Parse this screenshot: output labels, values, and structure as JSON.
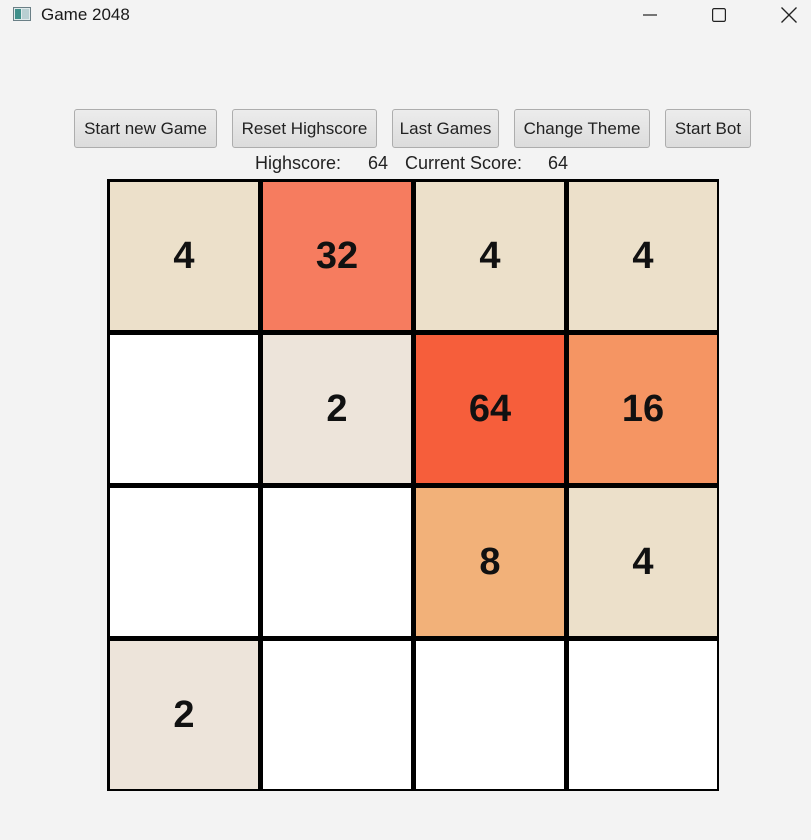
{
  "window": {
    "title": "Game 2048"
  },
  "toolbar": {
    "new_game_label": "Start new Game",
    "reset_highscore_label": "Reset Highscore",
    "last_games_label": "Last Games",
    "change_theme_label": "Change Theme",
    "start_bot_label": "Start Bot"
  },
  "scores": {
    "highscore_label": "Highscore:",
    "highscore_value": "64",
    "current_label": "Current Score:",
    "current_value": "64"
  },
  "board": {
    "rows": [
      [
        4,
        32,
        4,
        4
      ],
      [
        null,
        2,
        64,
        16
      ],
      [
        null,
        null,
        8,
        4
      ],
      [
        2,
        null,
        null,
        null
      ]
    ],
    "tile_colors": {
      "empty": "#ffffff",
      "2": "#ede4da",
      "4": "#ece0ca",
      "8": "#f2b179",
      "16": "#f59563",
      "32": "#f67c5f",
      "64": "#f65e3b"
    }
  },
  "icons": {
    "app": "game-window-icon",
    "minimize": "minimize-icon",
    "maximize": "maximize-icon",
    "close": "close-icon"
  }
}
